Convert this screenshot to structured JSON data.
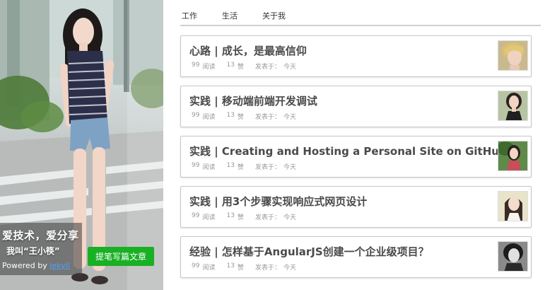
{
  "hero": {
    "slogan": "爱技术，爱分享",
    "name_line": "我叫“王小筷”",
    "powered_prefix": "Powered by ",
    "powered_link": "jekyll",
    "write_button": "提笔写篇文章"
  },
  "nav": {
    "tabs": [
      {
        "label": "工作"
      },
      {
        "label": "生活"
      },
      {
        "label": "关于我"
      }
    ]
  },
  "posts": [
    {
      "title": "心路 | 成长，是最高信仰",
      "reads": "99",
      "reads_label": "阅读",
      "likes": "13",
      "likes_label": "赞",
      "posted_label": "发表于：",
      "posted": "今天",
      "thumb_icon": "avatar-blonde-short-hair"
    },
    {
      "title": "实践 | 移动端前端开发调试",
      "reads": "99",
      "reads_label": "阅读",
      "likes": "13",
      "likes_label": "赞",
      "posted_label": "发表于：",
      "posted": "今天",
      "thumb_icon": "avatar-woman-dark-hair"
    },
    {
      "title": "实践 | Creating and Hosting a Personal Site on GitHub",
      "reads": "99",
      "reads_label": "阅读",
      "likes": "13",
      "likes_label": "赞",
      "posted_label": "发表于：",
      "posted": "今天",
      "thumb_icon": "avatar-woman-outdoor"
    },
    {
      "title": "实践 | 用3个步骤实现响应式网页设计",
      "reads": "99",
      "reads_label": "阅读",
      "likes": "13",
      "likes_label": "赞",
      "posted_label": "发表于：",
      "posted": "今天",
      "thumb_icon": "avatar-woman-long-hair"
    },
    {
      "title": "经验 | 怎样基于AngularJS创建一个企业级项目？",
      "reads": "99",
      "reads_label": "阅读",
      "likes": "13",
      "likes_label": "赞",
      "posted_label": "发表于：",
      "posted": "今天",
      "thumb_icon": "avatar-vintage-bw-portrait"
    }
  ],
  "colors": {
    "write_button": "#19b024",
    "link": "#4aa3ff",
    "title": "#4a4a4a",
    "meta": "#999999"
  }
}
